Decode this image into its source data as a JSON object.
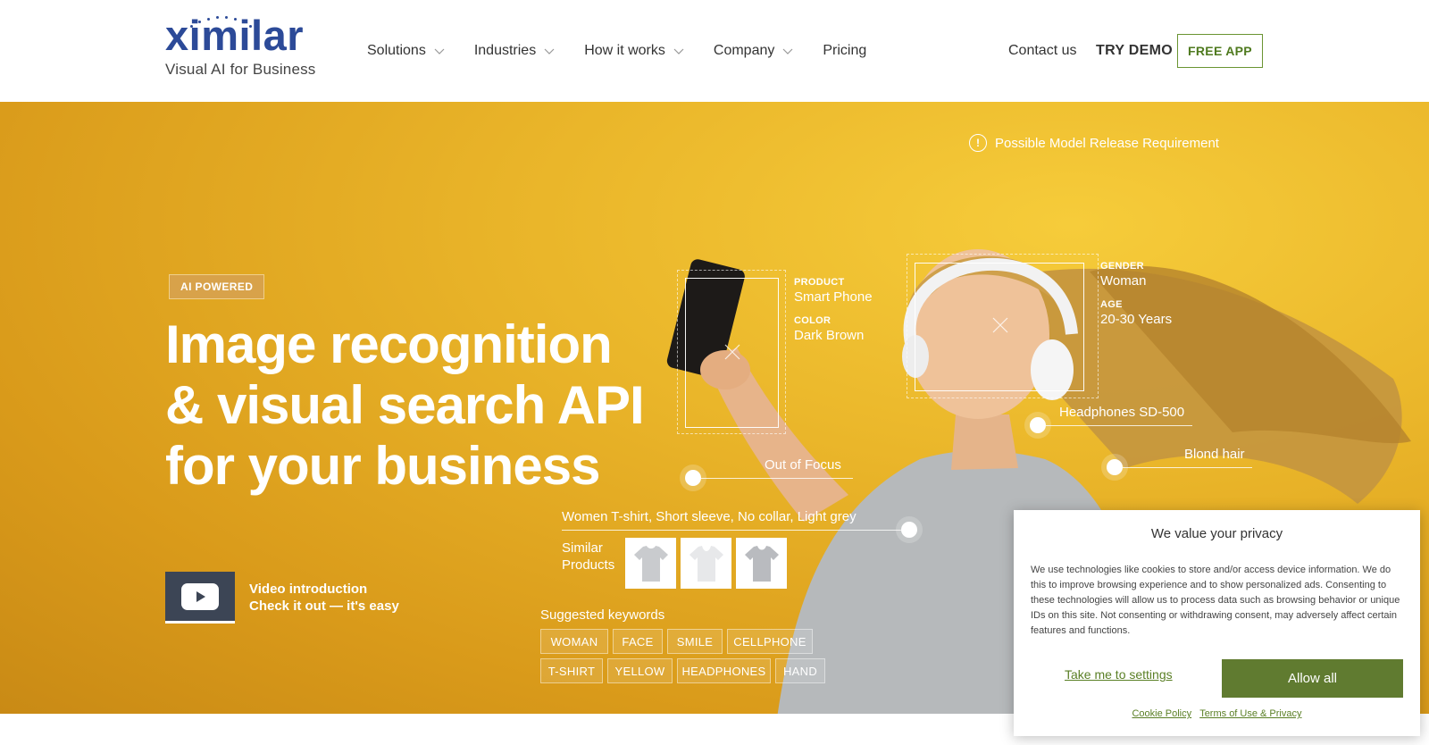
{
  "brand": {
    "name": "ximilar",
    "tagline": "Visual AI for Business",
    "color": "#2c4a98"
  },
  "nav": {
    "items": [
      {
        "label": "Solutions",
        "has_dropdown": true
      },
      {
        "label": "Industries",
        "has_dropdown": true
      },
      {
        "label": "How it works",
        "has_dropdown": true
      },
      {
        "label": "Company",
        "has_dropdown": true
      },
      {
        "label": "Pricing",
        "has_dropdown": false
      }
    ],
    "contact": "Contact us",
    "try_demo": "TRY DEMO",
    "free_app": "FREE APP",
    "accent": "#6a9432"
  },
  "hero": {
    "badge": "AI POWERED",
    "title_lines": [
      "Image recognition",
      "& visual search API",
      "for your business"
    ],
    "video": {
      "line1": "Video introduction",
      "line2": "Check it out — it's easy",
      "icon": "youtube-play-icon"
    },
    "warning": {
      "icon": "exclamation-circle-icon",
      "text": "Possible Model Release Requirement"
    },
    "annotations": {
      "product_label": "PRODUCT",
      "product_value": "Smart Phone",
      "color_label": "COLOR",
      "color_value": "Dark Brown",
      "gender_label": "GENDER",
      "gender_value": "Woman",
      "age_label": "AGE",
      "age_value": "20-30 Years",
      "headphones": "Headphones SD-500",
      "blond_hair": "Blond hair",
      "out_of_focus": "Out of Focus",
      "tshirt": "Women T-shirt, Short sleeve, No collar, Light grey"
    },
    "similar_products": {
      "label_line1": "Similar",
      "label_line2": "Products",
      "count": 3
    },
    "keywords_title": "Suggested keywords",
    "keywords_row1": [
      "WOMAN",
      "FACE",
      "SMILE",
      "CELLPHONE"
    ],
    "keywords_row2": [
      "T-SHIRT",
      "YELLOW",
      "HEADPHONES",
      "HAND"
    ]
  },
  "cookie": {
    "title": "We value your privacy",
    "text": "We use technologies like cookies to store and/or access device information. We do this to improve browsing experience and to show personalized ads. Consenting to these technologies will allow us to process data such as browsing behavior or unique IDs on this site. Not consenting or withdrawing consent, may adversely affect certain features and functions.",
    "settings_link": "Take me to settings",
    "allow_button": "Allow all",
    "policy_link": "Cookie Policy",
    "terms_link": "Terms of Use & Privacy",
    "button_color": "#607b30"
  }
}
